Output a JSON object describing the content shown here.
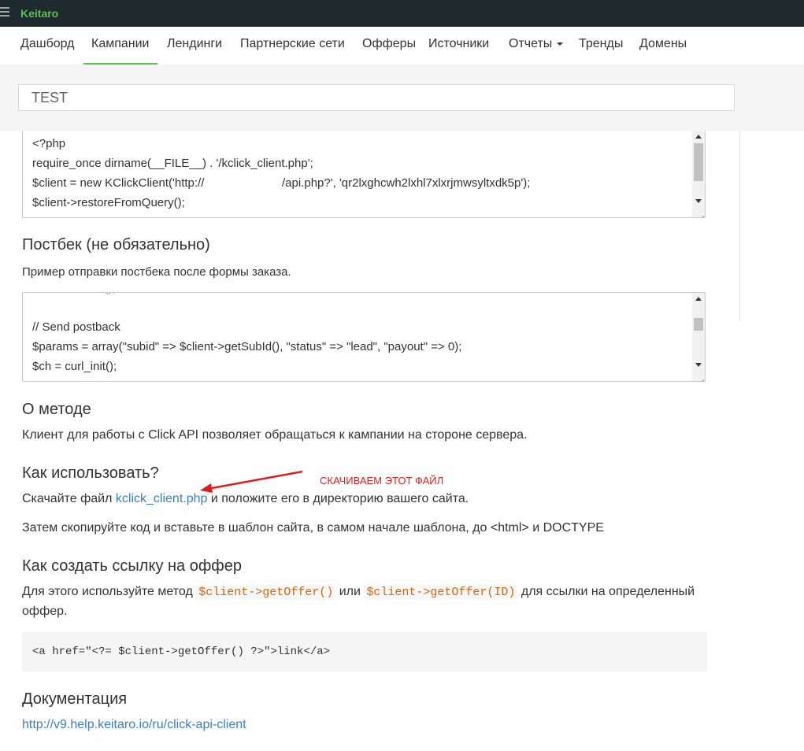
{
  "app": {
    "brand": "Keitaro"
  },
  "nav": {
    "items": [
      "Дашборд",
      "Кампании",
      "Лендинги",
      "Партнерские сети",
      "Офферы",
      "Источники",
      "Отчеты",
      "Тренды",
      "Домены"
    ],
    "active": "Кампании"
  },
  "campaign": {
    "name": "TEST"
  },
  "code_block_1": {
    "lines": [
      "<?php",
      "require_once dirname(__FILE__) . '/kclick_client.php';",
      "$client = new KClickClient('http://",
      "/api.php?', 'qr2lxghcwh2lxhl7xlxrjmwsyltxdk5p');",
      "$client->restoreFromQuery();"
    ]
  },
  "postback": {
    "title": "Постбек (не обязательно)",
    "desc": "Пример отправки постбека после формы заказа.",
    "lines": [
      "// Send postback",
      "$params = array(\"subid\" => $client->getSubId(), \"status\" => \"lead\", \"payout\" => 0);",
      "$ch = curl_init();"
    ]
  },
  "about": {
    "title": "О методе",
    "text": "Клиент для работы с Click API позволяет обращаться к кампании на стороне сервера."
  },
  "how": {
    "title": "Как использовать?",
    "download_prefix": "Скачайте файл",
    "download_link": "kclick_client.php",
    "download_suffix": "и положите его в директорию вашего сайта.",
    "step2": "Затем скопируйте код и вставьте в шаблон сайта, в самом начале шаблона, до <html> и DOCTYPE"
  },
  "annotation": {
    "text": "СКАЧИВАЕМ ЭТОТ ФАЙЛ",
    "color": "#e01d1d"
  },
  "offer": {
    "title": "Как создать ссылку на оффер",
    "text_prefix": "Для этого используйте метод",
    "method1": "$client->getOffer()",
    "text_or": "или",
    "method2": "$client->getOffer(ID)",
    "text_suffix": "для ссылки на определенный",
    "text_line2": "оффер.",
    "example": "<a href=\"<?= $client->getOffer() ?>\">link</a>"
  },
  "docs": {
    "title": "Документация",
    "url": "http://v9.help.keitaro.io/ru/click-api-client"
  },
  "colors": {
    "brand": "#5bc24e",
    "topbar": "#1f2a2e",
    "link": "#3d7ebf",
    "code": "#d9650f"
  }
}
